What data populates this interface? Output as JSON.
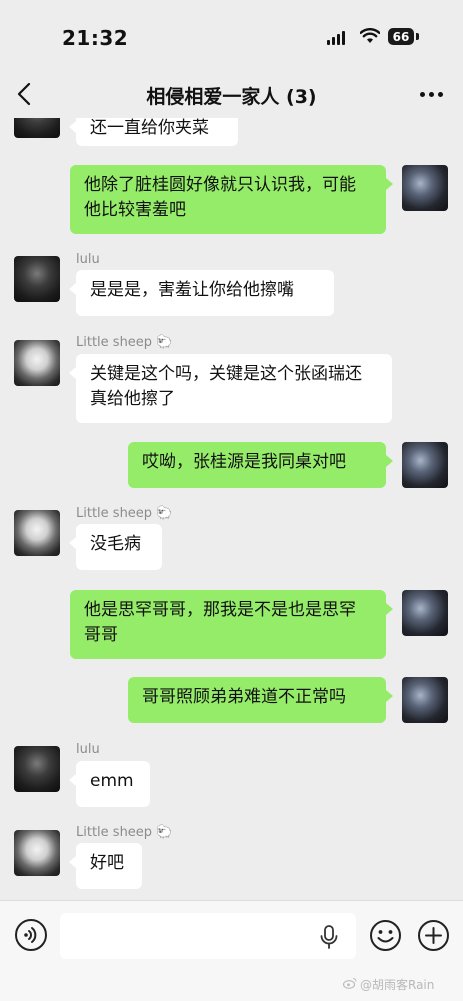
{
  "status": {
    "time": "21:32",
    "battery": "66"
  },
  "header": {
    "title": "相侵相爱一家人 (3)"
  },
  "messages": [
    {
      "side": "left",
      "sender": "",
      "text": "还一直给你夹菜"
    },
    {
      "side": "right",
      "text": "他除了脏桂圆好像就只认识我，可能他比较害羞吧"
    },
    {
      "side": "left",
      "sender": "lulu",
      "text": "是是是，害羞让你给他擦嘴"
    },
    {
      "side": "left",
      "sender": "Little sheep 🐑",
      "text": "关键是这个吗，关键是这个张函瑞还真给他擦了"
    },
    {
      "side": "right",
      "text": "哎呦，张桂源是我同桌对吧"
    },
    {
      "side": "left",
      "sender": "Little sheep 🐑",
      "text": "没毛病"
    },
    {
      "side": "right",
      "text": "他是思罕哥哥，那我是不是也是思罕哥哥"
    },
    {
      "side": "right",
      "text": "哥哥照顾弟弟难道不正常吗"
    },
    {
      "side": "left",
      "sender": "lulu",
      "text": "emm"
    },
    {
      "side": "left",
      "sender": "Little sheep 🐑",
      "text": "好吧"
    }
  ],
  "input": {
    "placeholder": ""
  },
  "watermark": "@胡雨客Rain",
  "colors": {
    "background": "#ededed",
    "bubble_mine": "#95ec69",
    "bubble_other": "#ffffff"
  }
}
